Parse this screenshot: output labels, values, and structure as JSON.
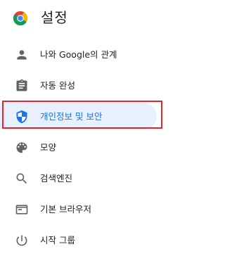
{
  "header": {
    "title": "설정",
    "logo_icon": "chrome-logo"
  },
  "menu": {
    "items": [
      {
        "label": "나와 Google의 관계",
        "icon": "person-icon"
      },
      {
        "label": "자동 완성",
        "icon": "clipboard-icon"
      },
      {
        "label": "개인정보 및 보안",
        "icon": "shield-icon",
        "selected": true
      },
      {
        "label": "모양",
        "icon": "palette-icon"
      },
      {
        "label": "검색엔진",
        "icon": "search-icon"
      },
      {
        "label": "기본 브라우저",
        "icon": "browser-icon"
      },
      {
        "label": "시작 그룹",
        "icon": "power-icon"
      }
    ]
  },
  "colors": {
    "accent": "#1a73e8",
    "selected_background": "#e8f0fe",
    "highlight_border": "#e0262b",
    "icon_gray": "#5f6368",
    "text": "#202124"
  }
}
